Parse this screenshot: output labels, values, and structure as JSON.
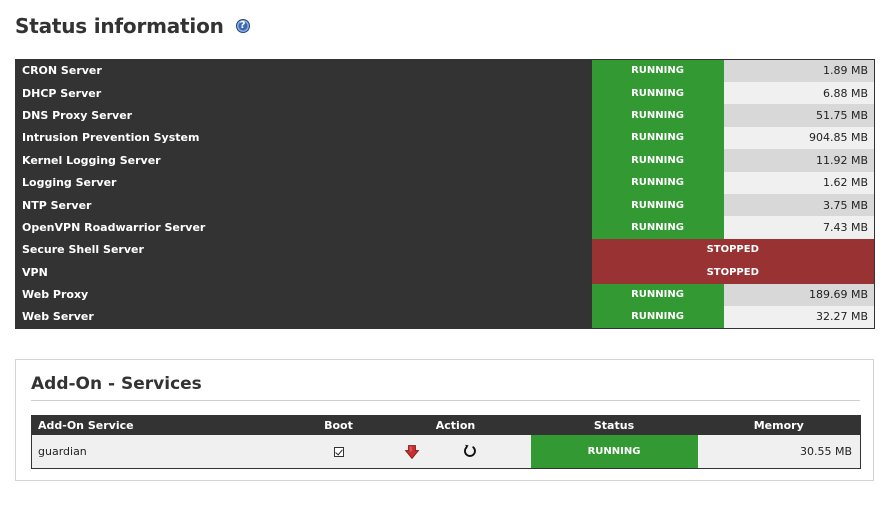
{
  "page": {
    "title": "Status information",
    "help_glyph": "?"
  },
  "services": [
    {
      "name": "CRON Server",
      "status": "RUNNING",
      "memory": "1.89 MB"
    },
    {
      "name": "DHCP Server",
      "status": "RUNNING",
      "memory": "6.88 MB"
    },
    {
      "name": "DNS Proxy Server",
      "status": "RUNNING",
      "memory": "51.75 MB"
    },
    {
      "name": "Intrusion Prevention System",
      "status": "RUNNING",
      "memory": "904.85 MB"
    },
    {
      "name": "Kernel Logging Server",
      "status": "RUNNING",
      "memory": "11.92 MB"
    },
    {
      "name": "Logging Server",
      "status": "RUNNING",
      "memory": "1.62 MB"
    },
    {
      "name": "NTP Server",
      "status": "RUNNING",
      "memory": "3.75 MB"
    },
    {
      "name": "OpenVPN Roadwarrior Server",
      "status": "RUNNING",
      "memory": "7.43 MB"
    },
    {
      "name": "Secure Shell Server",
      "status": "STOPPED",
      "memory": ""
    },
    {
      "name": "VPN",
      "status": "STOPPED",
      "memory": ""
    },
    {
      "name": "Web Proxy",
      "status": "RUNNING",
      "memory": "189.69 MB"
    },
    {
      "name": "Web Server",
      "status": "RUNNING",
      "memory": "32.27 MB"
    }
  ],
  "addons": {
    "title": "Add-On - Services",
    "columns": {
      "name": "Add-On Service",
      "boot": "Boot",
      "action": "Action",
      "status": "Status",
      "memory": "Memory"
    },
    "rows": [
      {
        "name": "guardian",
        "boot_checked": true,
        "status": "RUNNING",
        "memory": "30.55 MB"
      }
    ]
  },
  "icons": {
    "help": "help-icon",
    "boot": "checkbox-checked-icon",
    "stop": "stop-arrow-icon",
    "restart": "restart-icon"
  },
  "colors": {
    "running": "#339933",
    "stopped": "#993333",
    "header_dark": "#333333"
  }
}
